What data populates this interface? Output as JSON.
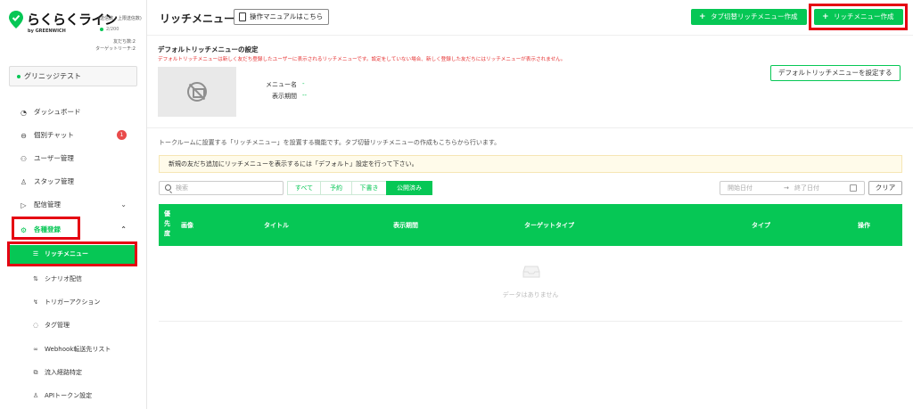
{
  "brand": {
    "logo_text": "らくらくライン",
    "logo_sub": "(送信数 / 上限送信数)",
    "by_line": "by GREENWICH",
    "send_count": "2/200",
    "friends_line": "友だち数:2",
    "target_line": "ターゲットリーチ:2",
    "accent": "#06c755",
    "highlight": "#e50012"
  },
  "account": {
    "name": "グリニッジテスト"
  },
  "sidebar": {
    "items": [
      {
        "label": "ダッシュボード",
        "icon": "dashboard-icon"
      },
      {
        "label": "個別チャット",
        "icon": "chat-icon",
        "badge": "1"
      },
      {
        "label": "ユーザー管理",
        "icon": "users-icon"
      },
      {
        "label": "スタッフ管理",
        "icon": "staff-icon"
      },
      {
        "label": "配信管理",
        "icon": "send-icon"
      },
      {
        "label": "各種登録",
        "icon": "settings-icon"
      }
    ],
    "sub_items": [
      {
        "label": "リッチメニュー",
        "icon": "menu-icon"
      },
      {
        "label": "シナリオ配信",
        "icon": "scenario-icon"
      },
      {
        "label": "トリガーアクション",
        "icon": "trigger-icon"
      },
      {
        "label": "タグ管理",
        "icon": "tag-icon"
      },
      {
        "label": "Webhook転送先リスト",
        "icon": "link-icon"
      },
      {
        "label": "流入経路特定",
        "icon": "route-icon"
      },
      {
        "label": "APIトークン設定",
        "icon": "api-icon"
      }
    ]
  },
  "header": {
    "title": "リッチメニュー",
    "manual_label": "操作マニュアルはこちら",
    "tab_rich_menu_label": "タブ切替リッチメニュー作成",
    "create_label": "リッチメニュー作成"
  },
  "default_menu": {
    "title": "デフォルトリッチメニューの設定",
    "note": "デフォルトリッチメニューは新しく友だち登録したユーザーに表示されるリッチメニューです。設定をしていない場合、新しく登録した友だちにはリッチメニューが表示されません。",
    "menu_name_label": "メニュー名",
    "menu_name_value": "-",
    "period_label": "表示期間",
    "period_value": "--",
    "set_button": "デフォルトリッチメニューを設定する"
  },
  "description": "トークルームに設置する「リッチメニュー」を設置する機能です。タブ切替リッチメニューの作成もこちらから行います。",
  "notice": "新規の友だち追加にリッチメニューを表示するには「デフォルト」設定を行って下さい。",
  "filters": {
    "search_placeholder": "検索",
    "tabs": [
      "すべて",
      "予約",
      "下書き",
      "公開済み"
    ],
    "active_tab": "公開済み",
    "start_placeholder": "開始日付",
    "arrow": "→",
    "end_placeholder": "終了日付",
    "clear": "クリア"
  },
  "table": {
    "columns": [
      "優先度",
      "画像",
      "タイトル",
      "表示期間",
      "ターゲットタイプ",
      "タイプ",
      "操作"
    ],
    "priority_chars": [
      "優",
      "先",
      "度"
    ],
    "rows": [],
    "empty_text": "データはありません"
  }
}
